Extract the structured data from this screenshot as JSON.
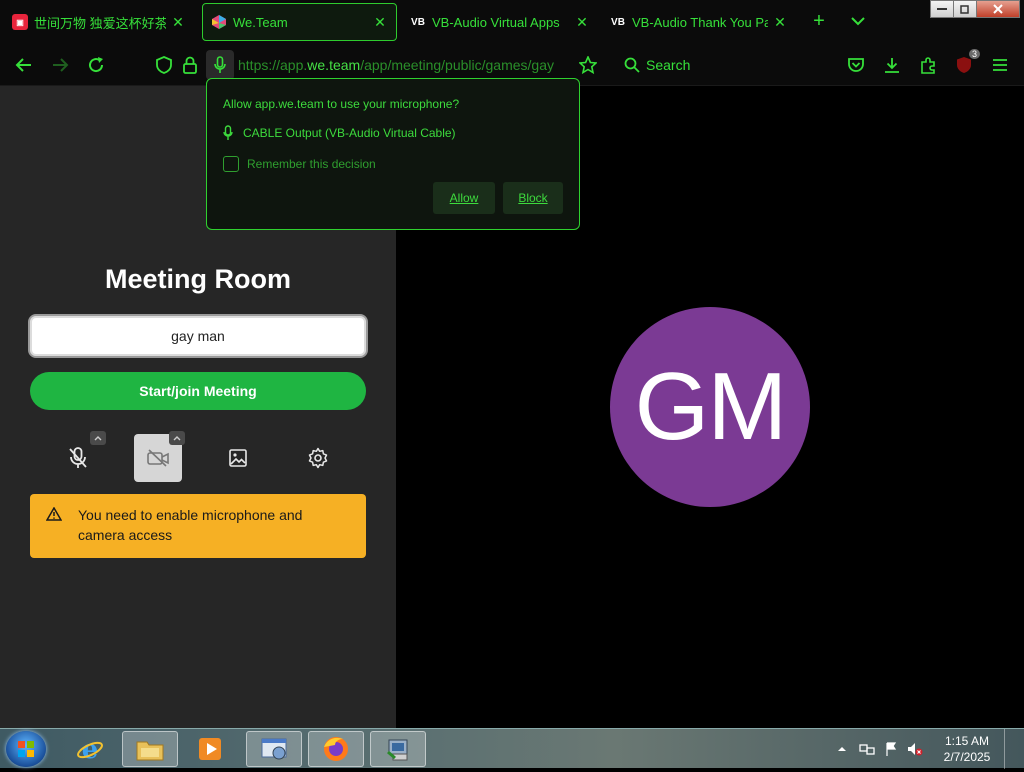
{
  "tabs": [
    {
      "title": "世间万物 独爱这杯好茶 - 小",
      "favicon": "red-app-logo-icon",
      "active": false
    },
    {
      "title": "We.Team",
      "favicon": "weteam-logo-icon",
      "active": true
    },
    {
      "title": "VB-Audio Virtual Apps",
      "favicon": "vb-logo-icon",
      "active": false
    },
    {
      "title": "VB-Audio Thank You Page",
      "favicon": "vb-logo-icon",
      "active": false
    }
  ],
  "tab_close_glyph": "✕",
  "new_tab_glyph": "+",
  "vb_logo_text": "VB",
  "address": {
    "prefix": "https://app.",
    "domain": "we.team",
    "path": "/app/meeting/public/games/gay"
  },
  "search": {
    "label": "Search"
  },
  "extension_badge": "3",
  "permission_popup": {
    "question": "Allow app.we.team to use your microphone?",
    "device": "CABLE Output (VB-Audio Virtual Cable)",
    "remember_label": "Remember this decision",
    "allow_label": "Allow",
    "block_label": "Block"
  },
  "meeting": {
    "title": "Meeting Room",
    "name_value": "gay man",
    "join_label": "Start/join Meeting",
    "warning": "You need to enable microphone and camera access",
    "avatar_initials": "GM"
  },
  "colors": {
    "theme_green": "#36e03a",
    "join_green": "#1fb542",
    "warning_amber": "#f6b024",
    "avatar_purple": "#7b3a94",
    "panel_bg": "#262626"
  },
  "taskbar": {
    "time": "1:15 AM",
    "date": "2/7/2025",
    "apps": [
      "internet-explorer-icon",
      "file-explorer-icon",
      "media-player-icon",
      "control-panel-icon",
      "firefox-icon",
      "installer-icon"
    ]
  }
}
